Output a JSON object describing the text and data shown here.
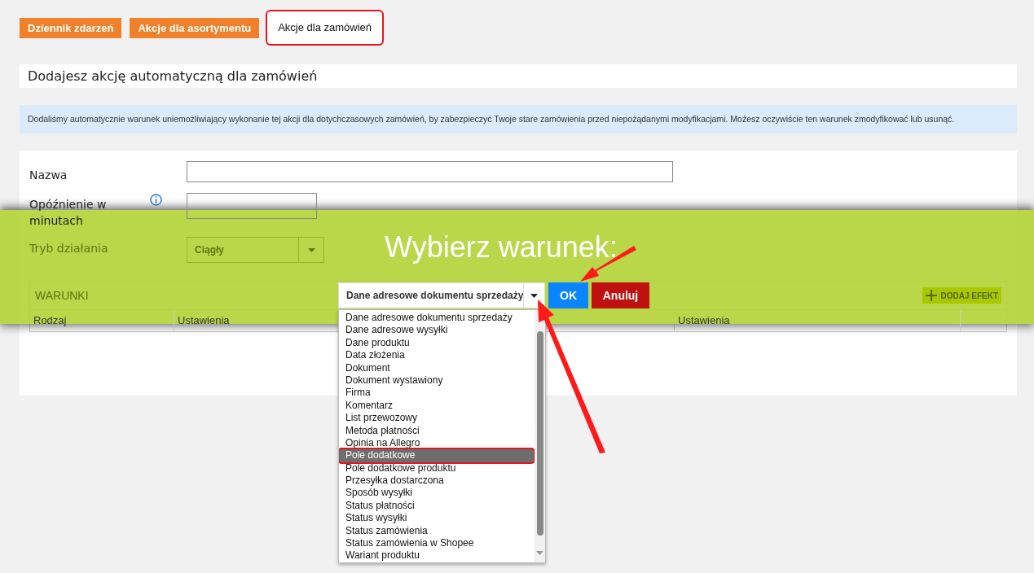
{
  "tabs": [
    {
      "label": "Dziennik zdarzeń",
      "selected": false
    },
    {
      "label": "Akcje dla asortymentu",
      "selected": false
    },
    {
      "label": "Akcje dla zamówień",
      "selected": true
    }
  ],
  "page_title": "Dodajesz akcję automatyczną dla zamówień",
  "info_message": "Dodaliśmy automatycznie warunek uniemożliwiający wykonanie tej akcji dla dotychczasowych zamówień, by zabezpieczyć Twoje stare zamówienia przed niepożądanymi modyfikacjami. Możesz oczywiście ten warunek zmodyfikować lub usunąć.",
  "form": {
    "fields": [
      {
        "kind": "text",
        "label": "Nazwa",
        "info": false
      },
      {
        "kind": "number",
        "label": "Opóźnienie w minutach",
        "info": true
      },
      {
        "kind": "select",
        "label": "Tryb działania",
        "value": "Ciągły",
        "info": false
      }
    ]
  },
  "conditions": {
    "title": "WARUNKI",
    "columns": [
      "Rodzaj",
      "Ustawienia"
    ]
  },
  "effects": {
    "button": "DODAJ EFEKT",
    "columns": [
      "Ustawienia"
    ]
  },
  "dialog": {
    "title": "Wybierz warunek:",
    "select_value": "Dane adresowe dokumentu sprzedaży",
    "ok": "OK",
    "cancel": "Anuluj",
    "options": [
      {
        "label": "Dane adresowe dokumentu sprzedaży",
        "selected": false
      },
      {
        "label": "Dane adresowe wysyłki",
        "selected": false
      },
      {
        "label": "Dane produktu",
        "selected": false
      },
      {
        "label": "Data złożenia",
        "selected": false
      },
      {
        "label": "Dokument",
        "selected": false
      },
      {
        "label": "Dokument wystawiony",
        "selected": false
      },
      {
        "label": "Firma",
        "selected": false
      },
      {
        "label": "Komentarz",
        "selected": false
      },
      {
        "label": "List przewozowy",
        "selected": false
      },
      {
        "label": "Metoda płatności",
        "selected": false
      },
      {
        "label": "Opinia na Allegro",
        "selected": false
      },
      {
        "label": "Pole dodatkowe",
        "selected": true
      },
      {
        "label": "Pole dodatkowe produktu",
        "selected": false
      },
      {
        "label": "Przesyłka dostarczona",
        "selected": false
      },
      {
        "label": "Sposób wysyłki",
        "selected": false
      },
      {
        "label": "Status płatności",
        "selected": false
      },
      {
        "label": "Status wysyłki",
        "selected": false
      },
      {
        "label": "Status zamówienia",
        "selected": false
      },
      {
        "label": "Status zamówienia w Shopee",
        "selected": false
      },
      {
        "label": "Wariant produktu",
        "selected": false
      }
    ]
  }
}
